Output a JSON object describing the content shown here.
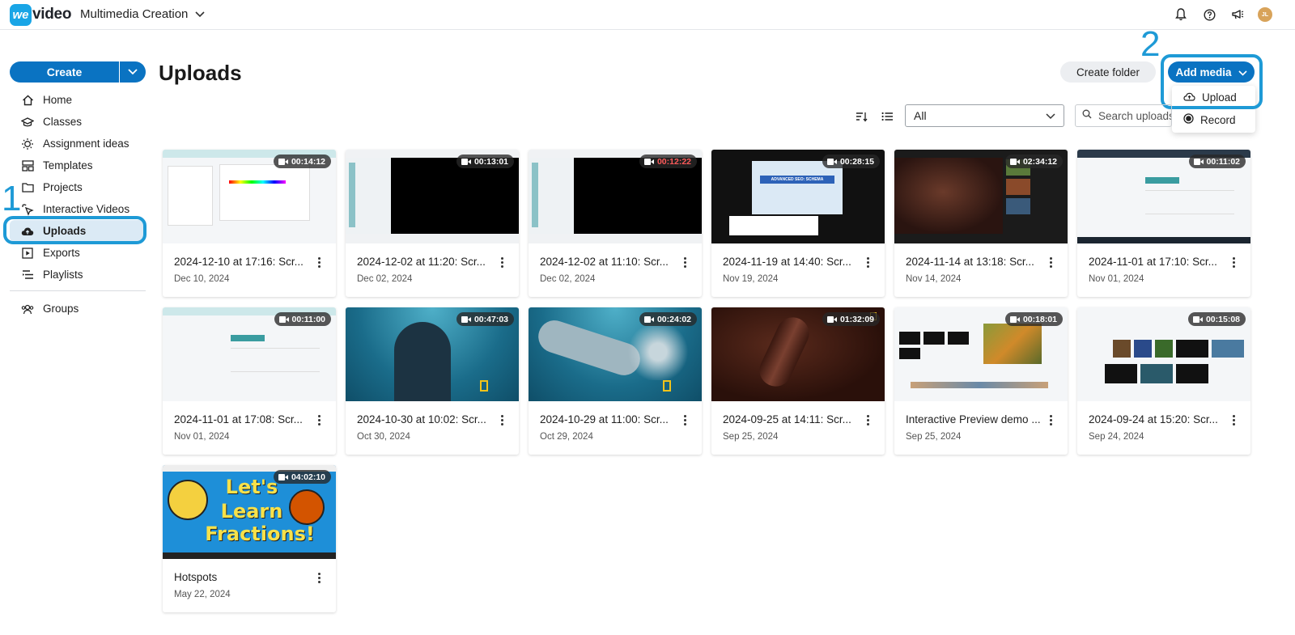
{
  "app": {
    "logo_we": "we",
    "logo_text": "video",
    "workspace": "Multimedia Creation"
  },
  "topbar": {
    "icons": [
      "bell-icon",
      "help-icon",
      "megaphone-icon"
    ],
    "avatar_initials": "JL"
  },
  "sidebar": {
    "create_label": "Create",
    "items": [
      {
        "label": "Home",
        "icon": "home-icon"
      },
      {
        "label": "Classes",
        "icon": "classes-icon"
      },
      {
        "label": "Assignment ideas",
        "icon": "lightbulb-icon"
      },
      {
        "label": "Templates",
        "icon": "templates-icon"
      },
      {
        "label": "Projects",
        "icon": "folder-icon"
      },
      {
        "label": "Interactive Videos",
        "icon": "interactive-icon"
      },
      {
        "label": "Uploads",
        "icon": "cloud-upload-icon",
        "active": true
      },
      {
        "label": "Exports",
        "icon": "exports-icon"
      },
      {
        "label": "Playlists",
        "icon": "playlist-icon"
      }
    ],
    "groups_label": "Groups"
  },
  "annotations": {
    "one": "1",
    "two": "2",
    "color": "#1e9ad6"
  },
  "main": {
    "title": "Uploads",
    "create_folder": "Create folder",
    "add_media": "Add media",
    "dropdown": {
      "upload": "Upload",
      "record": "Record"
    },
    "filter_value": "All",
    "search_placeholder": "Search uploads"
  },
  "cards": [
    {
      "title": "2024-12-10 at 17:16: Scr...",
      "date": "Dec 10, 2024",
      "duration": "00:14:12"
    },
    {
      "title": "2024-12-02 at 11:20: Scr...",
      "date": "Dec 02, 2024",
      "duration": "00:13:01"
    },
    {
      "title": "2024-12-02 at 11:10: Scr...",
      "date": "Dec 02, 2024",
      "duration": "00:12:22"
    },
    {
      "title": "2024-11-19 at 14:40: Scr...",
      "date": "Nov 19, 2024",
      "duration": "00:28:15"
    },
    {
      "title": "2024-11-14 at 13:18: Scr...",
      "date": "Nov 14, 2024",
      "duration": "02:34:12"
    },
    {
      "title": "2024-11-01 at 17:10: Scr...",
      "date": "Nov 01, 2024",
      "duration": "00:11:02"
    },
    {
      "title": "2024-11-01 at 17:08: Scr...",
      "date": "Nov 01, 2024",
      "duration": "00:11:00"
    },
    {
      "title": "2024-10-30 at 10:02: Scr...",
      "date": "Oct 30, 2024",
      "duration": "00:47:03"
    },
    {
      "title": "2024-10-29 at 11:00: Scr...",
      "date": "Oct 29, 2024",
      "duration": "00:24:02"
    },
    {
      "title": "2024-09-25 at 14:11: Scr...",
      "date": "Sep 25, 2024",
      "duration": "01:32:09"
    },
    {
      "title": "Interactive Preview demo ...",
      "date": "Sep 25, 2024",
      "duration": "00:18:01"
    },
    {
      "title": "2024-09-24 at 15:20: Scr...",
      "date": "Sep 24, 2024",
      "duration": "00:15:08"
    },
    {
      "title": "Hotspots",
      "date": "May 22, 2024",
      "duration": "04:02:10"
    }
  ],
  "thumb_texts": {
    "seo_banner": "ADVANCED SEO: SCHEMA",
    "fractions": [
      "Let's",
      "Learn",
      "Fractions!"
    ]
  }
}
